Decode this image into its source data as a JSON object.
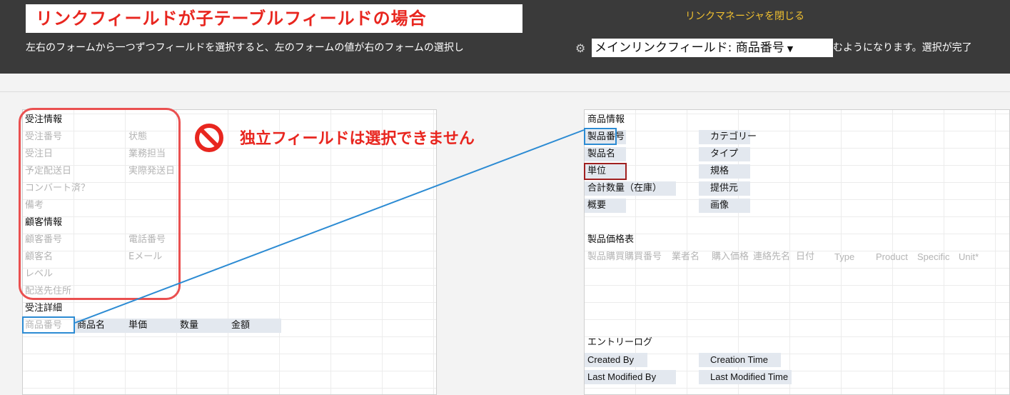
{
  "header": {
    "title": "リンクフィールドが子テーブルフィールドの場合",
    "close_link": "リンクマネージャを閉じる",
    "instruction_before": "左右のフォームから一つずつフィールドを選択すると、左のフォームの値が右のフォームの選択し",
    "select_value": "メインリンクフィールド: 商品番号",
    "instruction_after": "むようになります。選択が完了"
  },
  "annotation": {
    "warning_text": "独立フィールドは選択できません"
  },
  "left_form": {
    "section_order": "受注情報",
    "order_fields": [
      "受注番号",
      "状態",
      "受注日",
      "業務担当",
      "予定配送日",
      "実際発送日",
      "コンバート済？",
      "備考"
    ],
    "section_customer": "顧客情報",
    "customer_fields": [
      "顧客番号",
      "電話番号",
      "顧客名",
      "Eメール",
      "レベル",
      "配送先住所"
    ],
    "section_detail": "受注詳細",
    "detail_columns": [
      "商品番号",
      "商品名",
      "単価",
      "数量",
      "金額"
    ]
  },
  "right_form": {
    "section_product": "商品情報",
    "product_fields": [
      "製品番号",
      "カテゴリー",
      "製品名",
      "タイプ",
      "単位",
      "規格",
      "合計数量（在庫）",
      "提供元",
      "概要",
      "画像"
    ],
    "section_price": "製品価格表",
    "price_columns": [
      "製品購買",
      "購買番号",
      "業者名",
      "購入価格",
      "連絡先名",
      "日付",
      "Type",
      "Product",
      "Specific",
      "Unit*"
    ],
    "section_log": "エントリーログ",
    "log_fields": [
      "Created By",
      "Creation Time",
      "Last Modified By",
      "Last Modified Time"
    ]
  },
  "colors": {
    "header_bg": "#3a3a3a",
    "accent_red": "#e8261f",
    "link_yellow": "#f0c030",
    "highlight_blue": "#2c8bd3"
  }
}
